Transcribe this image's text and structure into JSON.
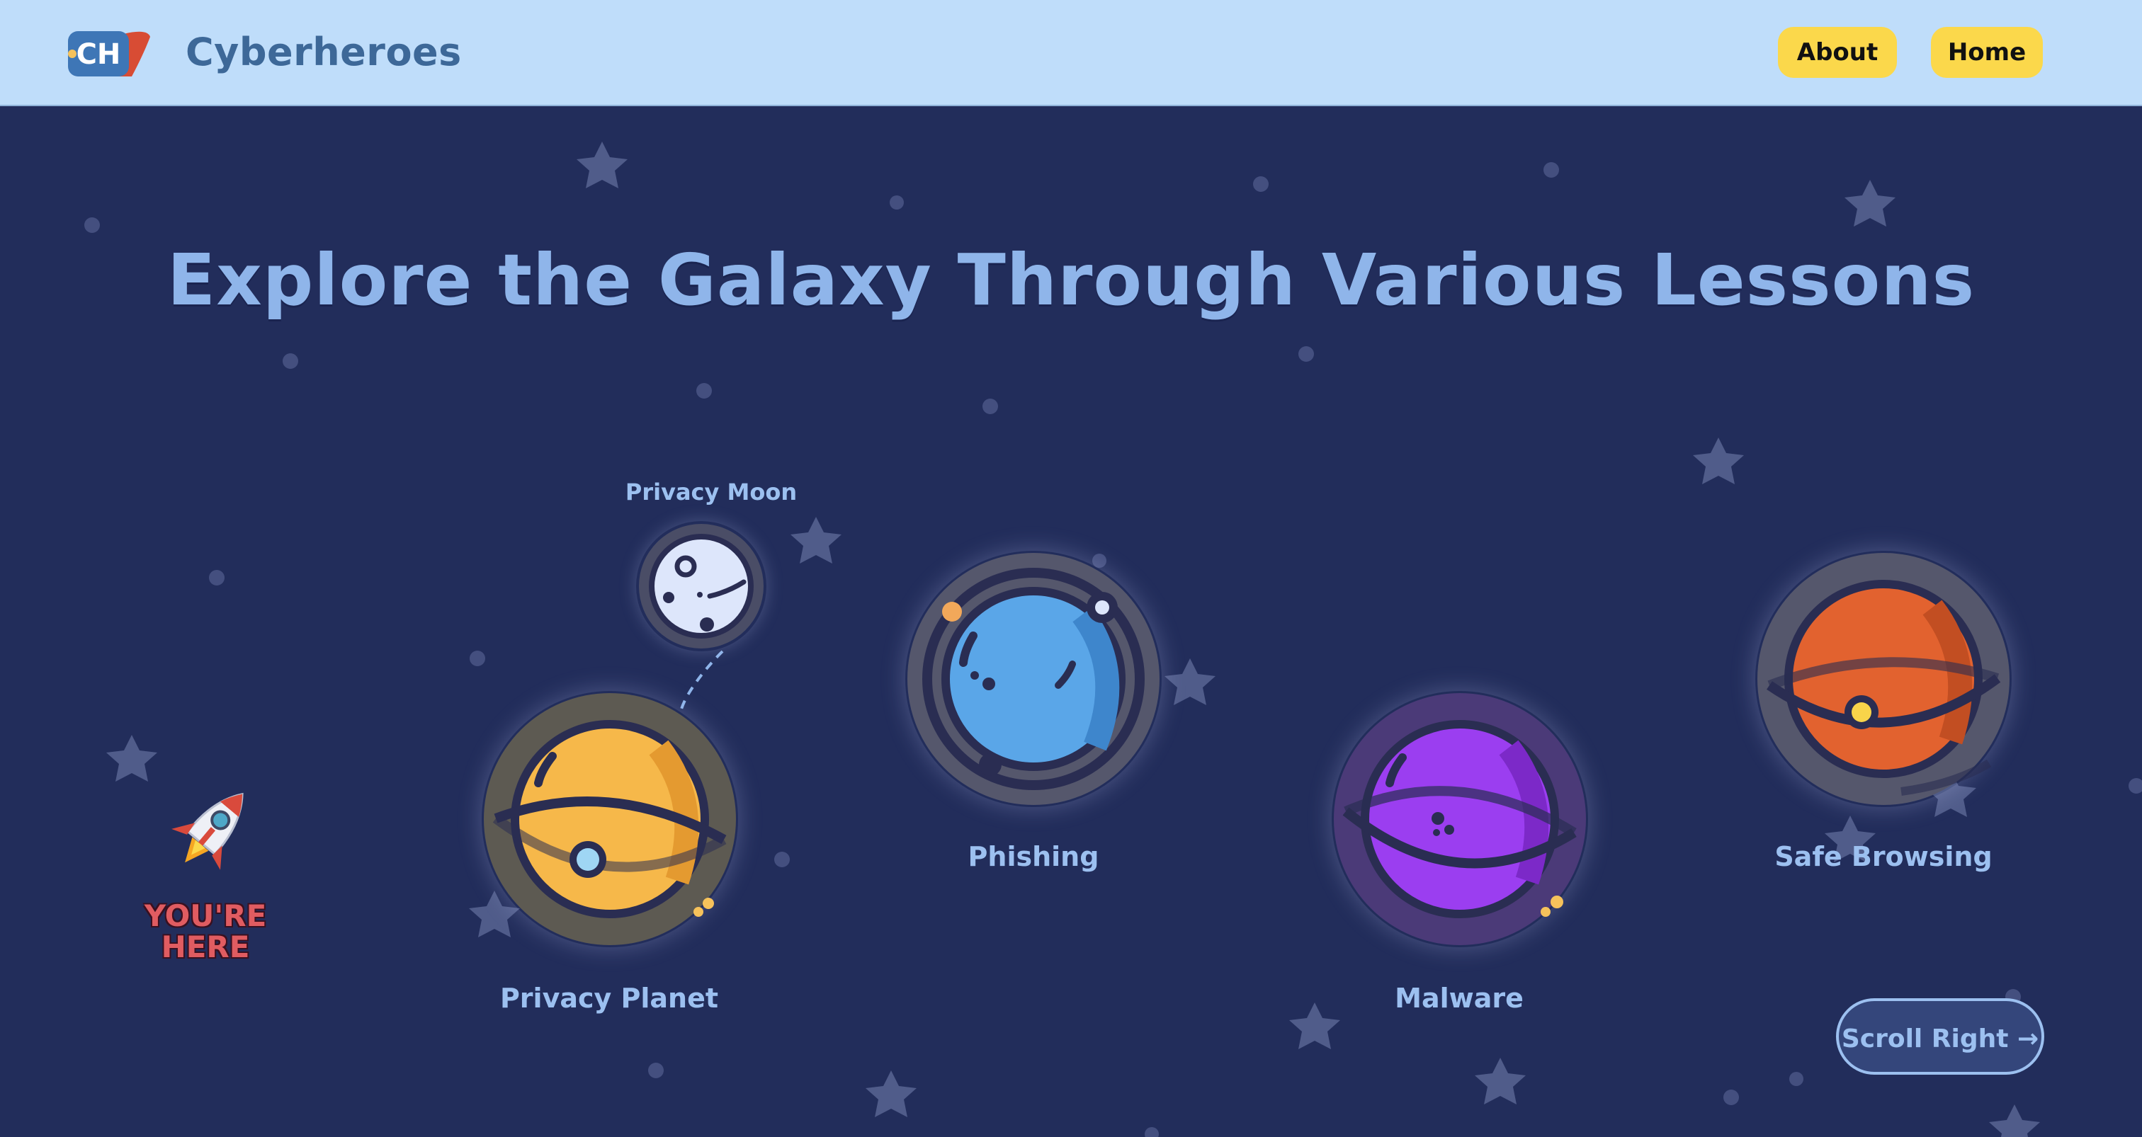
{
  "brand": {
    "name": "Cyberheroes",
    "logo_text": "CH"
  },
  "nav": {
    "about_label": "About",
    "home_label": "Home"
  },
  "headline": "Explore the Galaxy Through Various Lessons",
  "lessons": [
    {
      "name": "Privacy Planet",
      "color": "#f6b84a"
    },
    {
      "name": "Privacy Moon",
      "color": "#dde6fb"
    },
    {
      "name": "Phishing",
      "color": "#5aa6e8"
    },
    {
      "name": "Malware",
      "color": "#9b3ef0"
    },
    {
      "name": "Safe Browsing",
      "color": "#e2622f"
    }
  ],
  "marker": {
    "text": "YOU'RE HERE",
    "icon": "rocket-icon"
  },
  "scroll_button": {
    "label": "Scroll Right →"
  },
  "colors": {
    "navbar": "#bfddfa",
    "background": "#222d5b",
    "button": "#fbd84b",
    "text_accent": "#8fb5ea",
    "marker_text": "#e05c61"
  }
}
